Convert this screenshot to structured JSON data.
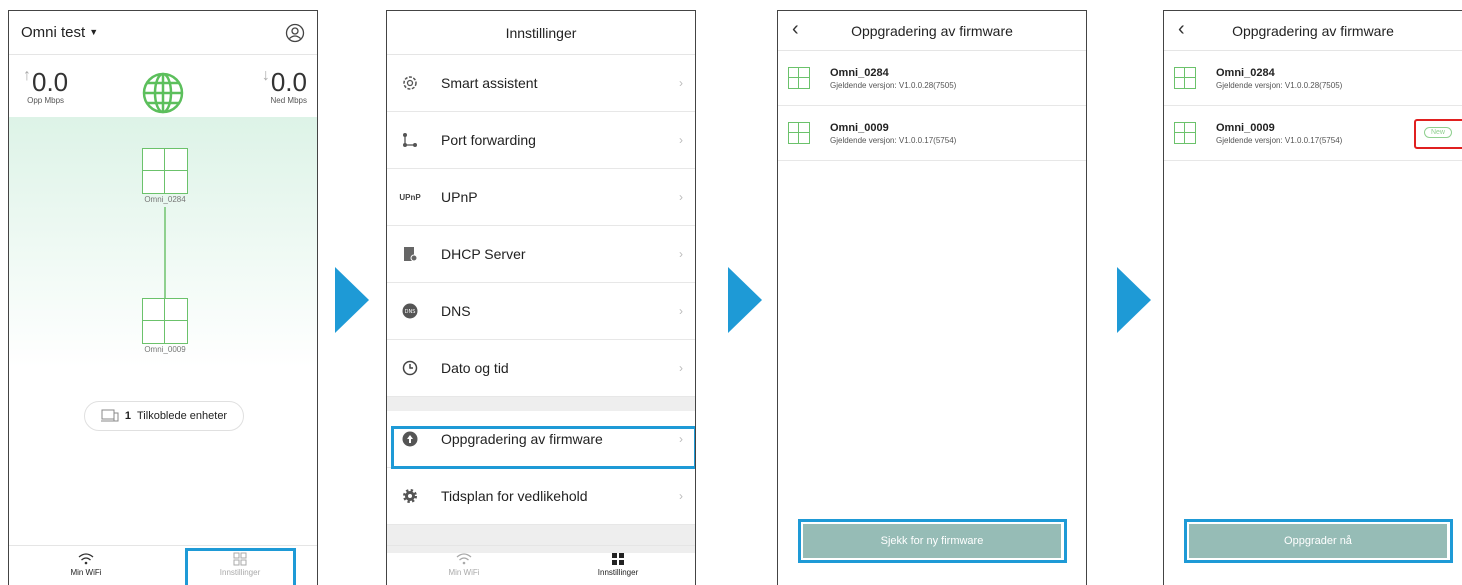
{
  "screen1": {
    "network_name": "Omni test",
    "upload": {
      "value": "0.0",
      "label": "Opp Mbps"
    },
    "download": {
      "value": "0.0",
      "label": "Ned Mbps"
    },
    "nodes": [
      {
        "name": "Omni_0284"
      },
      {
        "name": "Omni_0009"
      }
    ],
    "devices": {
      "count": "1",
      "label": "Tilkoblede enheter"
    },
    "tabs": {
      "wifi": "Min WiFi",
      "settings": "Innstillinger"
    }
  },
  "screen2": {
    "title": "Innstillinger",
    "items": [
      {
        "label": "Smart assistent",
        "icon": "gear-outline-icon"
      },
      {
        "label": "Port forwarding",
        "icon": "port-forward-icon"
      },
      {
        "label": "UPnP",
        "icon": "upnp-icon"
      },
      {
        "label": "DHCP Server",
        "icon": "dhcp-icon"
      },
      {
        "label": "DNS",
        "icon": "dns-icon"
      },
      {
        "label": "Dato og tid",
        "icon": "clock-icon"
      },
      {
        "label": "Oppgradering av firmware",
        "icon": "upgrade-icon"
      },
      {
        "label": "Tidsplan for vedlikehold",
        "icon": "gear-icon"
      }
    ],
    "tabs": {
      "wifi": "Min WiFi",
      "settings": "Innstillinger"
    }
  },
  "screen3": {
    "title": "Oppgradering av firmware",
    "devices": [
      {
        "name": "Omni_0284",
        "version": "Gjeldende versjon: V1.0.0.28(7505)"
      },
      {
        "name": "Omni_0009",
        "version": "Gjeldende versjon: V1.0.0.17(5754)"
      }
    ],
    "button": "Sjekk for ny firmware"
  },
  "screen4": {
    "title": "Oppgradering av firmware",
    "devices": [
      {
        "name": "Omni_0284",
        "version": "Gjeldende versjon: V1.0.0.28(7505)"
      },
      {
        "name": "Omni_0009",
        "version": "Gjeldende versjon: V1.0.0.17(5754)",
        "badge": "New"
      }
    ],
    "button": "Oppgrader nå"
  },
  "colors": {
    "accent": "#1e9ad6",
    "node_green": "#6bc26b",
    "button": "#96bcb6",
    "alert_red": "#e02020"
  }
}
